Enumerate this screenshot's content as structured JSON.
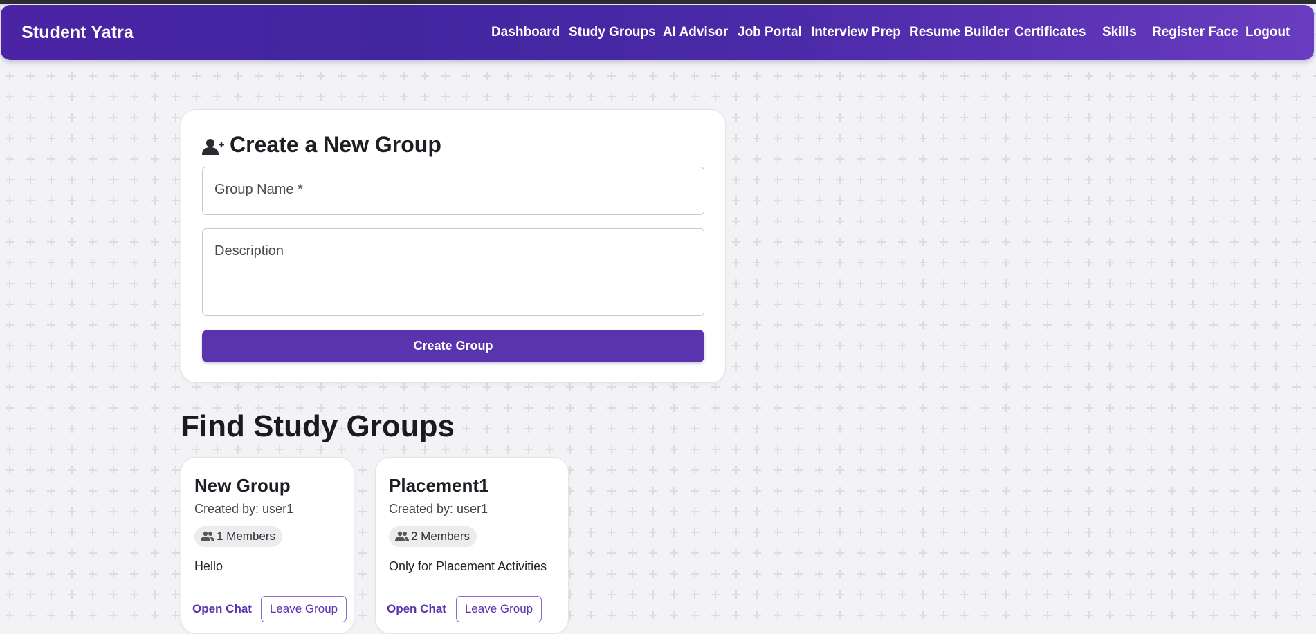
{
  "navbar": {
    "brand": "Student Yatra",
    "links": [
      {
        "label": "Dashboard"
      },
      {
        "label": "Study Groups"
      },
      {
        "label": "AI Advisor"
      },
      {
        "label": "Job Portal"
      },
      {
        "label": "Interview Prep"
      },
      {
        "label": "Resume Builder"
      },
      {
        "label": "Certificates"
      },
      {
        "label": "Skills"
      },
      {
        "label": "Register Face"
      },
      {
        "label": "Logout"
      }
    ]
  },
  "create_group": {
    "title": "Create a New Group",
    "icon": "user-add-icon",
    "name_placeholder": "Group Name *",
    "description_placeholder": "Description",
    "submit_label": "Create Group"
  },
  "find_groups": {
    "title": "Find Study Groups",
    "groups": [
      {
        "name": "New Group",
        "created_by": "Created by: user1",
        "members": "1 Members",
        "description": "Hello",
        "open_chat_label": "Open Chat",
        "leave_label": "Leave Group"
      },
      {
        "name": "Placement1",
        "created_by": "Created by: user1",
        "members": "2 Members",
        "description": "Only for Placement Activities",
        "open_chat_label": "Open Chat",
        "leave_label": "Leave Group"
      }
    ]
  },
  "colors": {
    "nav_gradient_start": "#4a24a4",
    "nav_gradient_end": "#6a3cc0",
    "accent": "#5a33ae",
    "background": "#f3f3f5"
  }
}
